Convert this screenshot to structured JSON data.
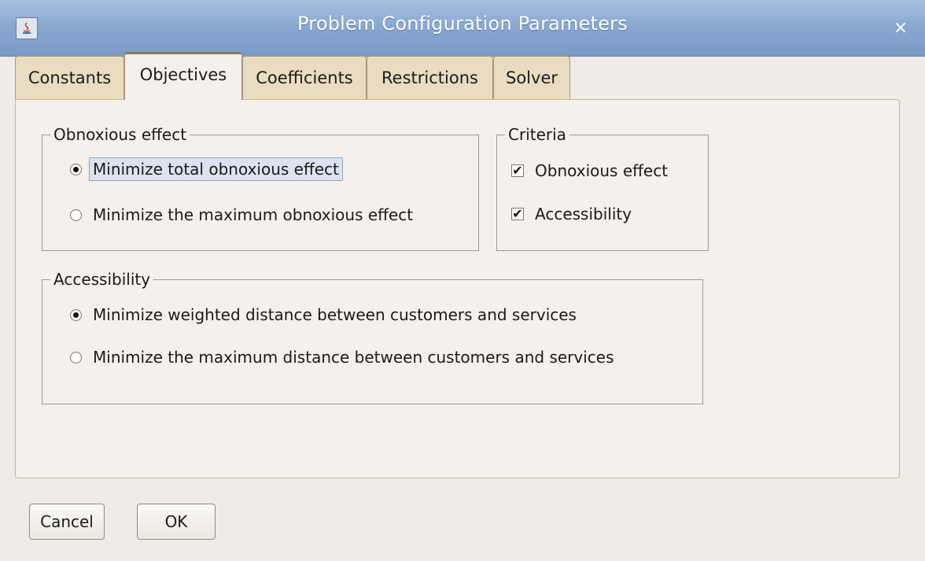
{
  "window": {
    "title": "Problem Configuration Parameters",
    "close_glyph": "×",
    "app_icon": "java-app-icon"
  },
  "tabs": [
    {
      "label": "Constants",
      "active": false
    },
    {
      "label": "Objectives",
      "active": true
    },
    {
      "label": "Coefficients",
      "active": false
    },
    {
      "label": "Restrictions",
      "active": false
    },
    {
      "label": "Solver",
      "active": false
    }
  ],
  "obnoxious_group": {
    "title": "Obnoxious effect",
    "options": [
      {
        "label": "Minimize total obnoxious effect",
        "selected": true
      },
      {
        "label": "Minimize the maximum obnoxious effect",
        "selected": false
      }
    ]
  },
  "criteria_group": {
    "title": "Criteria",
    "options": [
      {
        "label": "Obnoxious effect",
        "checked": true
      },
      {
        "label": "Accessibility",
        "checked": true
      }
    ]
  },
  "accessibility_group": {
    "title": "Accessibility",
    "options": [
      {
        "label": "Minimize weighted distance between customers and services",
        "selected": true
      },
      {
        "label": "Minimize the maximum distance between customers and services",
        "selected": false
      }
    ]
  },
  "buttons": {
    "cancel": "Cancel",
    "ok": "OK"
  },
  "check_glyph": "✔"
}
